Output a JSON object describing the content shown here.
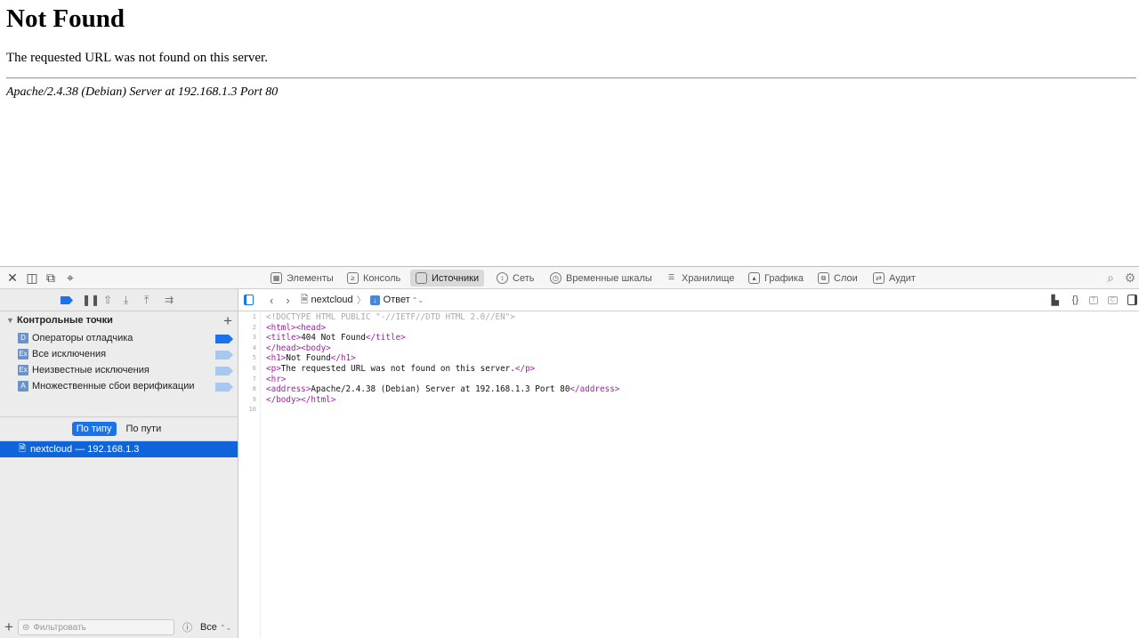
{
  "page": {
    "heading": "Not Found",
    "message": "The requested URL was not found on this server.",
    "address": "Apache/2.4.38 (Debian) Server at 192.168.1.3 Port 80"
  },
  "devtools": {
    "tabs": [
      {
        "label": "Элементы",
        "icon": "elements-icon"
      },
      {
        "label": "Консоль",
        "icon": "console-icon"
      },
      {
        "label": "Источники",
        "icon": "sources-icon",
        "active": true
      },
      {
        "label": "Сеть",
        "icon": "network-icon"
      },
      {
        "label": "Временные шкалы",
        "icon": "timelines-icon"
      },
      {
        "label": "Хранилище",
        "icon": "storage-icon"
      },
      {
        "label": "Графика",
        "icon": "graphics-icon"
      },
      {
        "label": "Слои",
        "icon": "layers-icon"
      },
      {
        "label": "Аудит",
        "icon": "audit-icon"
      }
    ],
    "sidebar": {
      "section_title": "Контрольные точки",
      "breakpoints": [
        {
          "badge": "D",
          "label": "Операторы отладчика",
          "enabled": true
        },
        {
          "badge": "Ex",
          "label": "Все исключения",
          "enabled": false
        },
        {
          "badge": "Ex",
          "label": "Неизвестные исключения",
          "enabled": false
        },
        {
          "badge": "A",
          "label": "Множественные сбои верификации",
          "enabled": false
        }
      ],
      "scope_by_type": "По типу",
      "scope_by_path": "По пути",
      "resource": "nextcloud — 192.168.1.3",
      "filter_placeholder": "Фильтровать",
      "filter_select": "Все"
    },
    "breadcrumb": {
      "resource": "nextcloud",
      "view": "Ответ"
    },
    "code": [
      [
        [
          "doc",
          "<!DOCTYPE HTML PUBLIC \"-//IETF//DTD HTML 2.0//EN\">"
        ]
      ],
      [
        [
          "tag",
          "<html><head>"
        ]
      ],
      [
        [
          "tag",
          "<title>"
        ],
        [
          "text",
          "404 Not Found"
        ],
        [
          "tag",
          "</title>"
        ]
      ],
      [
        [
          "tag",
          "</head><body>"
        ]
      ],
      [
        [
          "tag",
          "<h1>"
        ],
        [
          "text",
          "Not Found"
        ],
        [
          "tag",
          "</h1>"
        ]
      ],
      [
        [
          "tag",
          "<p>"
        ],
        [
          "text",
          "The requested URL was not found on this server."
        ],
        [
          "tag",
          "</p>"
        ]
      ],
      [
        [
          "tag",
          "<hr>"
        ]
      ],
      [
        [
          "tag",
          "<address>"
        ],
        [
          "text",
          "Apache/2.4.38 (Debian) Server at 192.168.1.3 Port 80"
        ],
        [
          "tag",
          "</address>"
        ]
      ],
      [
        [
          "tag",
          "</body></html>"
        ]
      ],
      []
    ]
  }
}
